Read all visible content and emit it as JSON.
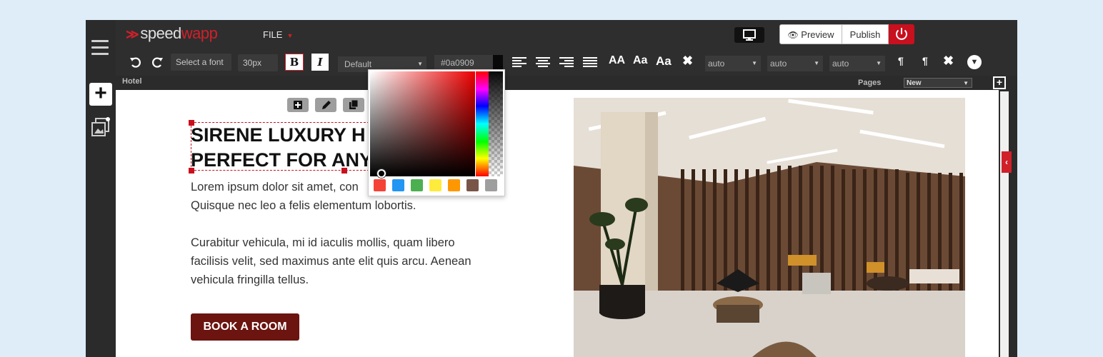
{
  "app": {
    "logo_prefix": "speed",
    "logo_suffix": "wapp",
    "file_menu": "FILE",
    "preview_label": "Preview",
    "publish_label": "Publish"
  },
  "toolbar": {
    "font_select": "Select a font",
    "font_size": "30px",
    "bold": "B",
    "italic": "I",
    "style_select": "Default",
    "color_value": "#0a0909",
    "case_upper": "AA",
    "case_small": "Aa",
    "case_title": "Aa",
    "auto1": "auto",
    "auto2": "auto",
    "auto3": "auto"
  },
  "subbar": {
    "page_name": "Hotel",
    "pages_label": "Pages",
    "pages_select": "New"
  },
  "content": {
    "heading_line1": "SIRENE LUXURY H",
    "heading_line2": "PERFECT FOR ANY",
    "para1_line1": "Lorem ipsum dolor sit amet, con",
    "para1_line2": "Quisque nec leo a felis elementum lobortis.",
    "para2": "Curabitur vehicula, mi id iaculis mollis, quam libero facilisis velit, sed maximus ante elit quis arcu. Aenean vehicula fringilla tellus.",
    "book_button": "BOOK A ROOM"
  },
  "colors": {
    "accent": "#d0202a",
    "button": "#6b1410",
    "swatches": [
      "#f44336",
      "#2196f3",
      "#4caf50",
      "#ffeb3b",
      "#ff9800",
      "#795548",
      "#9e9e9e"
    ]
  }
}
